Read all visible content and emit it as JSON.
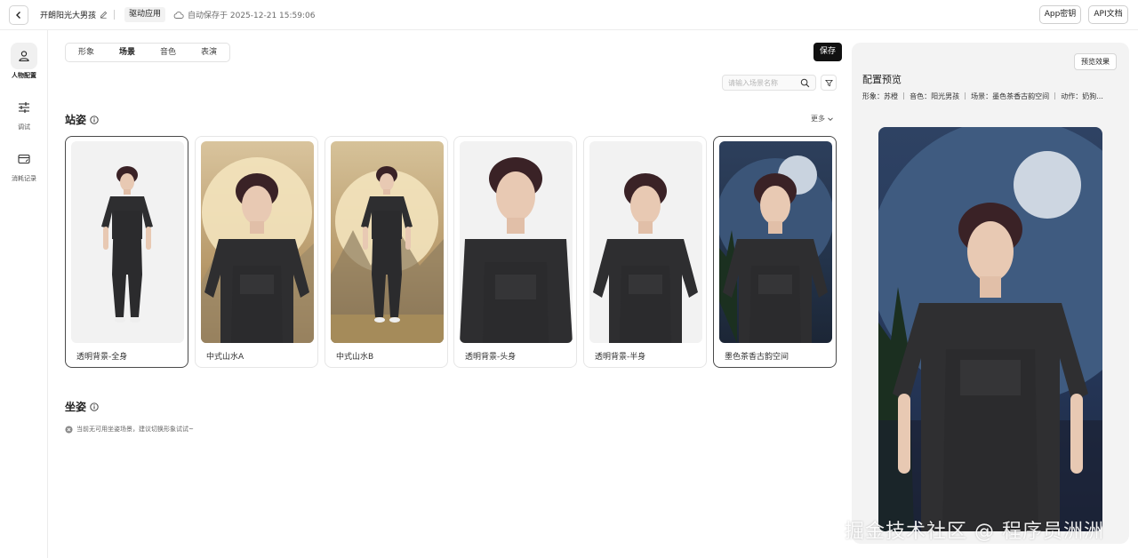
{
  "header": {
    "app_name": "开朗阳光大男孩",
    "drive_tag": "驱动应用",
    "autosave": "自动保存于 2025-12-21 15:59:06",
    "app_key_button": "App密钥",
    "api_docs_button": "API文档"
  },
  "sidebar": {
    "items": [
      {
        "label": "人物配置",
        "icon": "person-icon",
        "active": true
      },
      {
        "label": "调试",
        "icon": "sliders-icon",
        "active": false
      },
      {
        "label": "消耗记录",
        "icon": "card-icon",
        "active": false
      }
    ]
  },
  "tabs": [
    {
      "label": "形象",
      "active": false
    },
    {
      "label": "场景",
      "active": true
    },
    {
      "label": "音色",
      "active": false
    },
    {
      "label": "表演",
      "active": false
    }
  ],
  "save_button": "保存",
  "search": {
    "placeholder": "请输入场景名称",
    "value": ""
  },
  "standing": {
    "title": "站姿",
    "more_label": "更多",
    "cards": [
      {
        "label": "透明背景-全身",
        "selected": true
      },
      {
        "label": "中式山水A",
        "selected": false
      },
      {
        "label": "中式山水B",
        "selected": false
      },
      {
        "label": "透明背景-头身",
        "selected": false
      },
      {
        "label": "透明背景-半身",
        "selected": false
      },
      {
        "label": "墨色茶香古韵空间",
        "selected": true
      }
    ]
  },
  "sitting": {
    "title": "坐姿",
    "empty_note": "当前无可用坐姿场景，建议切换形象试试~"
  },
  "preview": {
    "effect_button": "预览效果",
    "title": "配置预览",
    "summary": "形象：苏橙 ｜ 音色：阳光男孩 ｜ 场景：墨色茶香古韵空间 ｜ 动作：奶狗..."
  },
  "watermark": "掘金技术社区 @ 程序员洲洲"
}
